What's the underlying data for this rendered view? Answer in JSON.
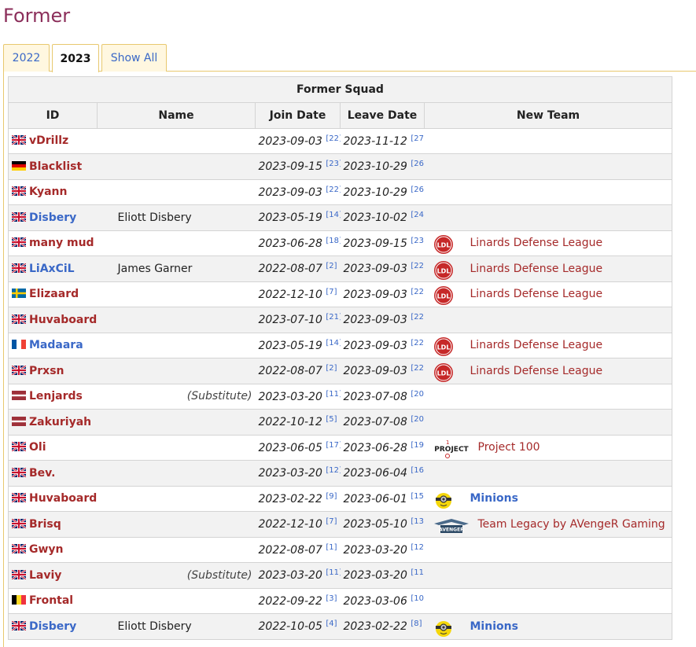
{
  "section_heading": "Former",
  "tabs": [
    {
      "label": "2022",
      "active": false
    },
    {
      "label": "2023",
      "active": true
    },
    {
      "label": "Show All",
      "active": false
    }
  ],
  "table": {
    "caption": "Former Squad",
    "headers": {
      "id": "ID",
      "name": "Name",
      "join": "Join Date",
      "leave": "Leave Date",
      "new_team": "New Team"
    },
    "rows": [
      {
        "flag": "uk",
        "id": "vDrillz",
        "id_color": "red",
        "name": "",
        "join": "2023-09-03",
        "join_ref": "[22]",
        "leave": "2023-11-12",
        "leave_ref": "[27]",
        "team": "",
        "team_logo": ""
      },
      {
        "flag": "de",
        "id": "Blacklist",
        "id_color": "red",
        "name": "",
        "join": "2023-09-15",
        "join_ref": "[23]",
        "leave": "2023-10-29",
        "leave_ref": "[26]",
        "team": "",
        "team_logo": ""
      },
      {
        "flag": "uk",
        "id": "Kyann",
        "id_color": "red",
        "name": "",
        "join": "2023-09-03",
        "join_ref": "[22]",
        "leave": "2023-10-29",
        "leave_ref": "[26]",
        "team": "",
        "team_logo": ""
      },
      {
        "flag": "uk",
        "id": "Disbery",
        "id_color": "blue",
        "name": "Eliott Disbery",
        "join": "2023-05-19",
        "join_ref": "[14]",
        "leave": "2023-10-02",
        "leave_ref": "[24]",
        "team": "",
        "team_logo": ""
      },
      {
        "flag": "uk",
        "id": "many mud",
        "id_color": "red",
        "name": "",
        "join": "2023-06-28",
        "join_ref": "[18]",
        "leave": "2023-09-15",
        "leave_ref": "[23]",
        "team": "Linards Defense League",
        "team_logo": "ldl"
      },
      {
        "flag": "uk",
        "id": "LiAxCiL",
        "id_color": "blue",
        "name": "James Garner",
        "join": "2022-08-07",
        "join_ref": "[2]",
        "leave": "2023-09-03",
        "leave_ref": "[22]",
        "team": "Linards Defense League",
        "team_logo": "ldl"
      },
      {
        "flag": "se",
        "id": "Elizaard",
        "id_color": "red",
        "name": "",
        "join": "2022-12-10",
        "join_ref": "[7]",
        "leave": "2023-09-03",
        "leave_ref": "[22]",
        "team": "Linards Defense League",
        "team_logo": "ldl"
      },
      {
        "flag": "uk",
        "id": "Huvaboard",
        "id_color": "red",
        "name": "",
        "join": "2023-07-10",
        "join_ref": "[21]",
        "leave": "2023-09-03",
        "leave_ref": "[22]",
        "team": "",
        "team_logo": ""
      },
      {
        "flag": "fr",
        "id": "Madaara",
        "id_color": "blue",
        "name": "",
        "join": "2023-05-19",
        "join_ref": "[14]",
        "leave": "2023-09-03",
        "leave_ref": "[22]",
        "team": "Linards Defense League",
        "team_logo": "ldl"
      },
      {
        "flag": "uk",
        "id": "Prxsn",
        "id_color": "red",
        "name": "",
        "join": "2022-08-07",
        "join_ref": "[2]",
        "leave": "2023-09-03",
        "leave_ref": "[22]",
        "team": "Linards Defense League",
        "team_logo": "ldl"
      },
      {
        "flag": "lv",
        "id": "Lenjards",
        "id_color": "red",
        "name": "",
        "sub": "(Substitute)",
        "join": "2023-03-20",
        "join_ref": "[11]",
        "leave": "2023-07-08",
        "leave_ref": "[20]",
        "team": "",
        "team_logo": ""
      },
      {
        "flag": "lv",
        "id": "Zakuriyah",
        "id_color": "red",
        "name": "",
        "join": "2022-10-12",
        "join_ref": "[5]",
        "leave": "2023-07-08",
        "leave_ref": "[20]",
        "team": "",
        "team_logo": ""
      },
      {
        "flag": "uk",
        "id": "Oli",
        "id_color": "red",
        "name": "",
        "join": "2023-06-05",
        "join_ref": "[17]",
        "leave": "2023-06-28",
        "leave_ref": "[19]",
        "team": "Project 100",
        "team_logo": "project"
      },
      {
        "flag": "uk",
        "id": "Bev.",
        "id_color": "red",
        "name": "",
        "join": "2023-03-20",
        "join_ref": "[12]",
        "leave": "2023-06-04",
        "leave_ref": "[16]",
        "team": "",
        "team_logo": ""
      },
      {
        "flag": "uk",
        "id": "Huvaboard",
        "id_color": "red",
        "name": "",
        "join": "2023-02-22",
        "join_ref": "[9]",
        "leave": "2023-06-01",
        "leave_ref": "[15]",
        "team": "Minions",
        "team_logo": "minion",
        "team_style": "bold-blue"
      },
      {
        "flag": "uk",
        "id": "Brisq",
        "id_color": "red",
        "name": "",
        "join": "2022-12-10",
        "join_ref": "[7]",
        "leave": "2023-05-10",
        "leave_ref": "[13]",
        "team": "Team Legacy by AVengeR Gaming",
        "team_logo": "avenger"
      },
      {
        "flag": "uk",
        "id": "Gwyn",
        "id_color": "red",
        "name": "",
        "join": "2022-08-07",
        "join_ref": "[1]",
        "leave": "2023-03-20",
        "leave_ref": "[12]",
        "team": "",
        "team_logo": ""
      },
      {
        "flag": "uk",
        "id": "Laviy",
        "id_color": "red",
        "name": "",
        "sub": "(Substitute)",
        "join": "2023-03-20",
        "join_ref": "[11]",
        "leave": "2023-03-20",
        "leave_ref": "[11]",
        "team": "",
        "team_logo": ""
      },
      {
        "flag": "be",
        "id": "Frontal",
        "id_color": "red",
        "name": "",
        "join": "2022-09-22",
        "join_ref": "[3]",
        "leave": "2023-03-06",
        "leave_ref": "[10]",
        "team": "",
        "team_logo": ""
      },
      {
        "flag": "uk",
        "id": "Disbery",
        "id_color": "blue",
        "name": "Eliott Disbery",
        "join": "2022-10-05",
        "join_ref": "[4]",
        "leave": "2023-02-22",
        "leave_ref": "[8]",
        "team": "Minions",
        "team_logo": "minion",
        "team_style": "bold-blue"
      }
    ]
  },
  "logo_text": {
    "ldl": "LDL",
    "project": "PROJECT",
    "avenger": "AVENGER"
  },
  "colors": {
    "heading": "#8b2e5a",
    "link_red": "#a52a2a",
    "link_blue": "#3a68c7",
    "tab_border": "#e8c86e",
    "tab_bg": "#fff7e0",
    "ldl_red": "#c62828"
  }
}
